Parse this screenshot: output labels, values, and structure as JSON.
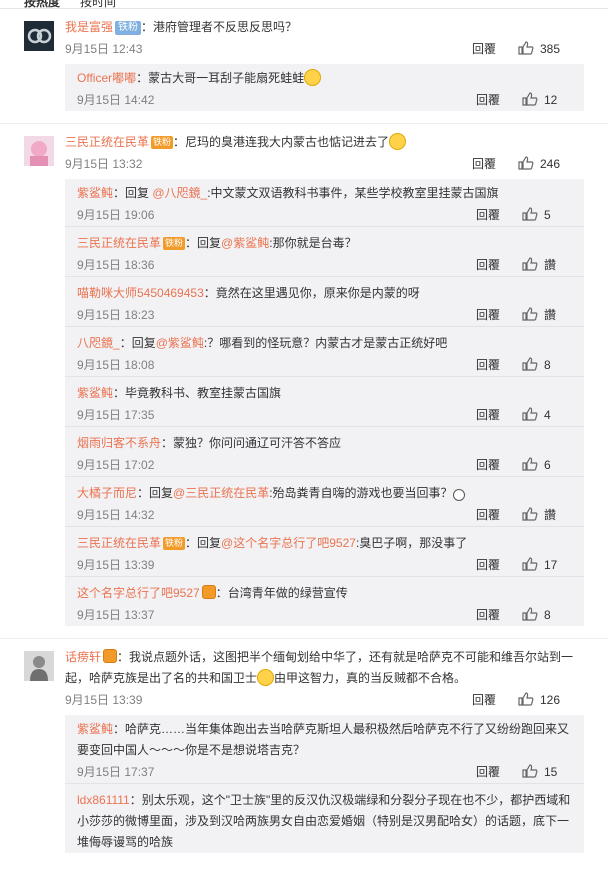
{
  "tabs": {
    "hot": "按热度",
    "time": "按时间"
  },
  "ui": {
    "reply": "回覆"
  },
  "comments": [
    {
      "user": "我是富强",
      "badge": "铁粉",
      "text": "：港府管理者不反思反思吗？",
      "time": "9月15日 12:43",
      "likes": "385",
      "replies": [
        {
          "user": "Officer嘟嘟",
          "text": "：蒙古大哥一耳刮子能扇死蛙蛙",
          "time": "9月15日 14:42",
          "likes": "12"
        }
      ]
    },
    {
      "user": "三民正统在民革",
      "badge": "铁粉",
      "text": "：尼玛的臭港连我大内蒙古也惦记进去了",
      "time": "9月15日 13:32",
      "likes": "246",
      "replies": [
        {
          "user": "紫鲨鲀",
          "pre": "：回复 ",
          "at": "@八咫鏡_",
          "text": ":中文蒙文双语教科书事件，某些学校教室里挂蒙古国旗",
          "time": "9月15日 19:06",
          "likes": "5"
        },
        {
          "user": "三民正统在民革",
          "pre": "：回复",
          "at": "@紫鲨鲀",
          "text": ":那你就是台毒？",
          "time": "9月15日 18:36",
          "likes": "讚"
        },
        {
          "user": "喵勒咪大师5450469453",
          "text": "：竟然在这里遇见你，原来你是内蒙的呀",
          "time": "9月15日 18:23",
          "likes": "讚"
        },
        {
          "user": "八咫鏡_",
          "pre": "：回复",
          "at": "@紫鲨鲀",
          "text": ":？哪看到的怪玩意？内蒙古才是蒙古正统好吧",
          "time": "9月15日 18:08",
          "likes": "8"
        },
        {
          "user": "紫鲨鲀",
          "text": "：毕竟教科书、教室挂蒙古国旗",
          "time": "9月15日 17:35",
          "likes": "4"
        },
        {
          "user": "烟雨归客不系舟",
          "text": "：蒙独？你问问通辽可汗答不答应",
          "time": "9月15日 17:02",
          "likes": "6"
        },
        {
          "user": "大橘子而尼",
          "pre": "：回复",
          "at": "@三民正统在民革",
          "text": ":殆岛粪青自嗨的游戏也要当回事？",
          "time": "9月15日 14:32",
          "likes": "讚"
        },
        {
          "user": "三民正统在民革",
          "pre": "：回复",
          "at": "@这个名字总行了吧9527",
          "text": ":臭巴子啊，那没事了",
          "time": "9月15日 13:39",
          "likes": "17"
        },
        {
          "user": "这个名字总行了吧9527",
          "text": "：台湾青年做的绿营宣传",
          "time": "9月15日 13:37",
          "likes": "8"
        }
      ]
    },
    {
      "user": "话痨轩",
      "text1": "：我说点题外话，这图把半个缅甸划给中华了，还有就是哈萨克不可能和维吾尔站到一",
      "text2": "起，哈萨克族是出了名的共和国卫士",
      "text3": "由甲这智力，真的当反贼都不合格。",
      "time": "9月15日 13:39",
      "likes": "126",
      "replies": [
        {
          "user": "紫鲨鲀",
          "text1": "：哈萨克……当年集体跑出去当哈萨克斯坦人最积极然后哈萨克不行了又纷纷跑回来又",
          "text2": "要变回中国人～～～你是不是想说塔吉克？",
          "time": "9月15日 17:37",
          "likes": "15"
        },
        {
          "user": "ldx861111",
          "text1": "：别太乐观，这个\"卫士族\"里的反汉仇汉极端绿和分裂分子现在也不少，都护西域和",
          "text2": "小莎莎的微博里面，涉及到汉哈两族男女自由恋爱婚姻（特别是汉男配哈女）的话题，底下一",
          "text3": "堆侮辱谩骂的哈族"
        }
      ]
    }
  ]
}
